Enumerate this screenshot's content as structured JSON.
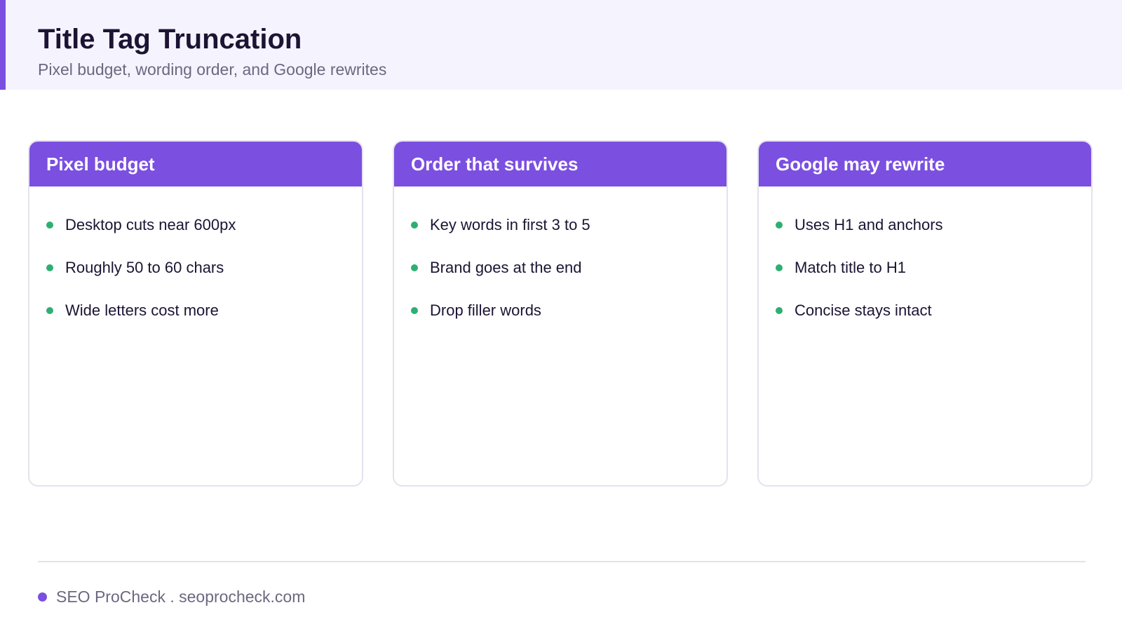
{
  "header": {
    "title": "Title Tag Truncation",
    "subtitle": "Pixel budget, wording order, and Google rewrites"
  },
  "cards": [
    {
      "title": "Pixel budget",
      "items": [
        "Desktop cuts near 600px",
        "Roughly 50 to 60 chars",
        "Wide letters cost more"
      ]
    },
    {
      "title": "Order that survives",
      "items": [
        "Key words in first 3 to 5",
        "Brand goes at the end",
        "Drop filler words"
      ]
    },
    {
      "title": "Google may rewrite",
      "items": [
        "Uses H1 and anchors",
        "Match title to H1",
        "Concise stays intact"
      ]
    }
  ],
  "footer": {
    "text": "SEO ProCheck . seoprocheck.com"
  },
  "colors": {
    "accent": "#7b4fe0",
    "bullet": "#2eaf72",
    "header_bg": "#f5f3fe"
  }
}
